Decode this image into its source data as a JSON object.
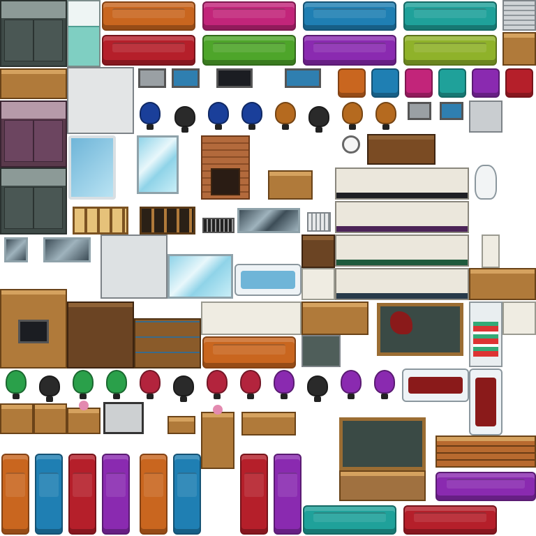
{
  "sheet": {
    "background": "#ffffff",
    "description_visible_text": ""
  },
  "palette": {
    "orange": "#c9661f",
    "red": "#b51f2a",
    "magenta": "#c2257a",
    "blue": "#1f7fb3",
    "teal": "#1fa19a",
    "green": "#4ea52a",
    "purple": "#8a2ab0",
    "lime": "#8fb22a",
    "crimson": "#b3243d",
    "navy": "#1a3f9a",
    "black": "#2a2a2a",
    "brown_chair": "#b56a1f"
  },
  "tiles": [
    {
      "name": "locker-gray-top",
      "kind": "lockers-gray"
    },
    {
      "name": "bed-teal",
      "kind": "bed"
    },
    {
      "name": "sofa-orange",
      "kind": "sofa",
      "color": "orange"
    },
    {
      "name": "sofa-magenta",
      "kind": "sofa",
      "color": "magenta"
    },
    {
      "name": "sofa-blue",
      "kind": "sofa",
      "color": "blue"
    },
    {
      "name": "sofa-teal",
      "kind": "sofa",
      "color": "teal"
    },
    {
      "name": "sofa-red",
      "kind": "sofa",
      "color": "red"
    },
    {
      "name": "sofa-green",
      "kind": "sofa",
      "color": "green"
    },
    {
      "name": "sofa-purple",
      "kind": "sofa",
      "color": "purple"
    },
    {
      "name": "sofa-lime",
      "kind": "sofa",
      "color": "lime"
    },
    {
      "name": "dresser-wood",
      "kind": "wood"
    },
    {
      "name": "kitchen-cabinet-white",
      "kind": "metal"
    },
    {
      "name": "laptop",
      "kind": "screen"
    },
    {
      "name": "tv-black",
      "kind": "screen"
    },
    {
      "name": "aquarium",
      "kind": "screen-blue"
    },
    {
      "name": "armchair-set",
      "kind": "armchairs"
    },
    {
      "name": "office-chairs-row1",
      "kind": "chairs"
    },
    {
      "name": "office-chairs-row2",
      "kind": "chairs"
    },
    {
      "name": "locker-purple",
      "kind": "lockers-purple"
    },
    {
      "name": "pool-tile",
      "kind": "water"
    },
    {
      "name": "glass-pane",
      "kind": "glass"
    },
    {
      "name": "brick-fireplace",
      "kind": "brick"
    },
    {
      "name": "small-table",
      "kind": "wood"
    },
    {
      "name": "kitchen-counter-rows",
      "kind": "sinkrow"
    },
    {
      "name": "toilet",
      "kind": "toilet"
    },
    {
      "name": "wall-clock",
      "kind": "clock"
    },
    {
      "name": "wardrobe-wood",
      "kind": "wood-dark"
    },
    {
      "name": "chalkboard-blood",
      "kind": "board"
    },
    {
      "name": "chalkboard-plain",
      "kind": "board"
    },
    {
      "name": "fridge",
      "kind": "fridge"
    },
    {
      "name": "bathtub-water",
      "kind": "bath"
    },
    {
      "name": "bathtub-blood",
      "kind": "bath"
    },
    {
      "name": "bookshelf",
      "kind": "shelf"
    },
    {
      "name": "couch-vertical-set",
      "kind": "sofa-vertical"
    },
    {
      "name": "office-chairs-row3",
      "kind": "chairs"
    }
  ]
}
